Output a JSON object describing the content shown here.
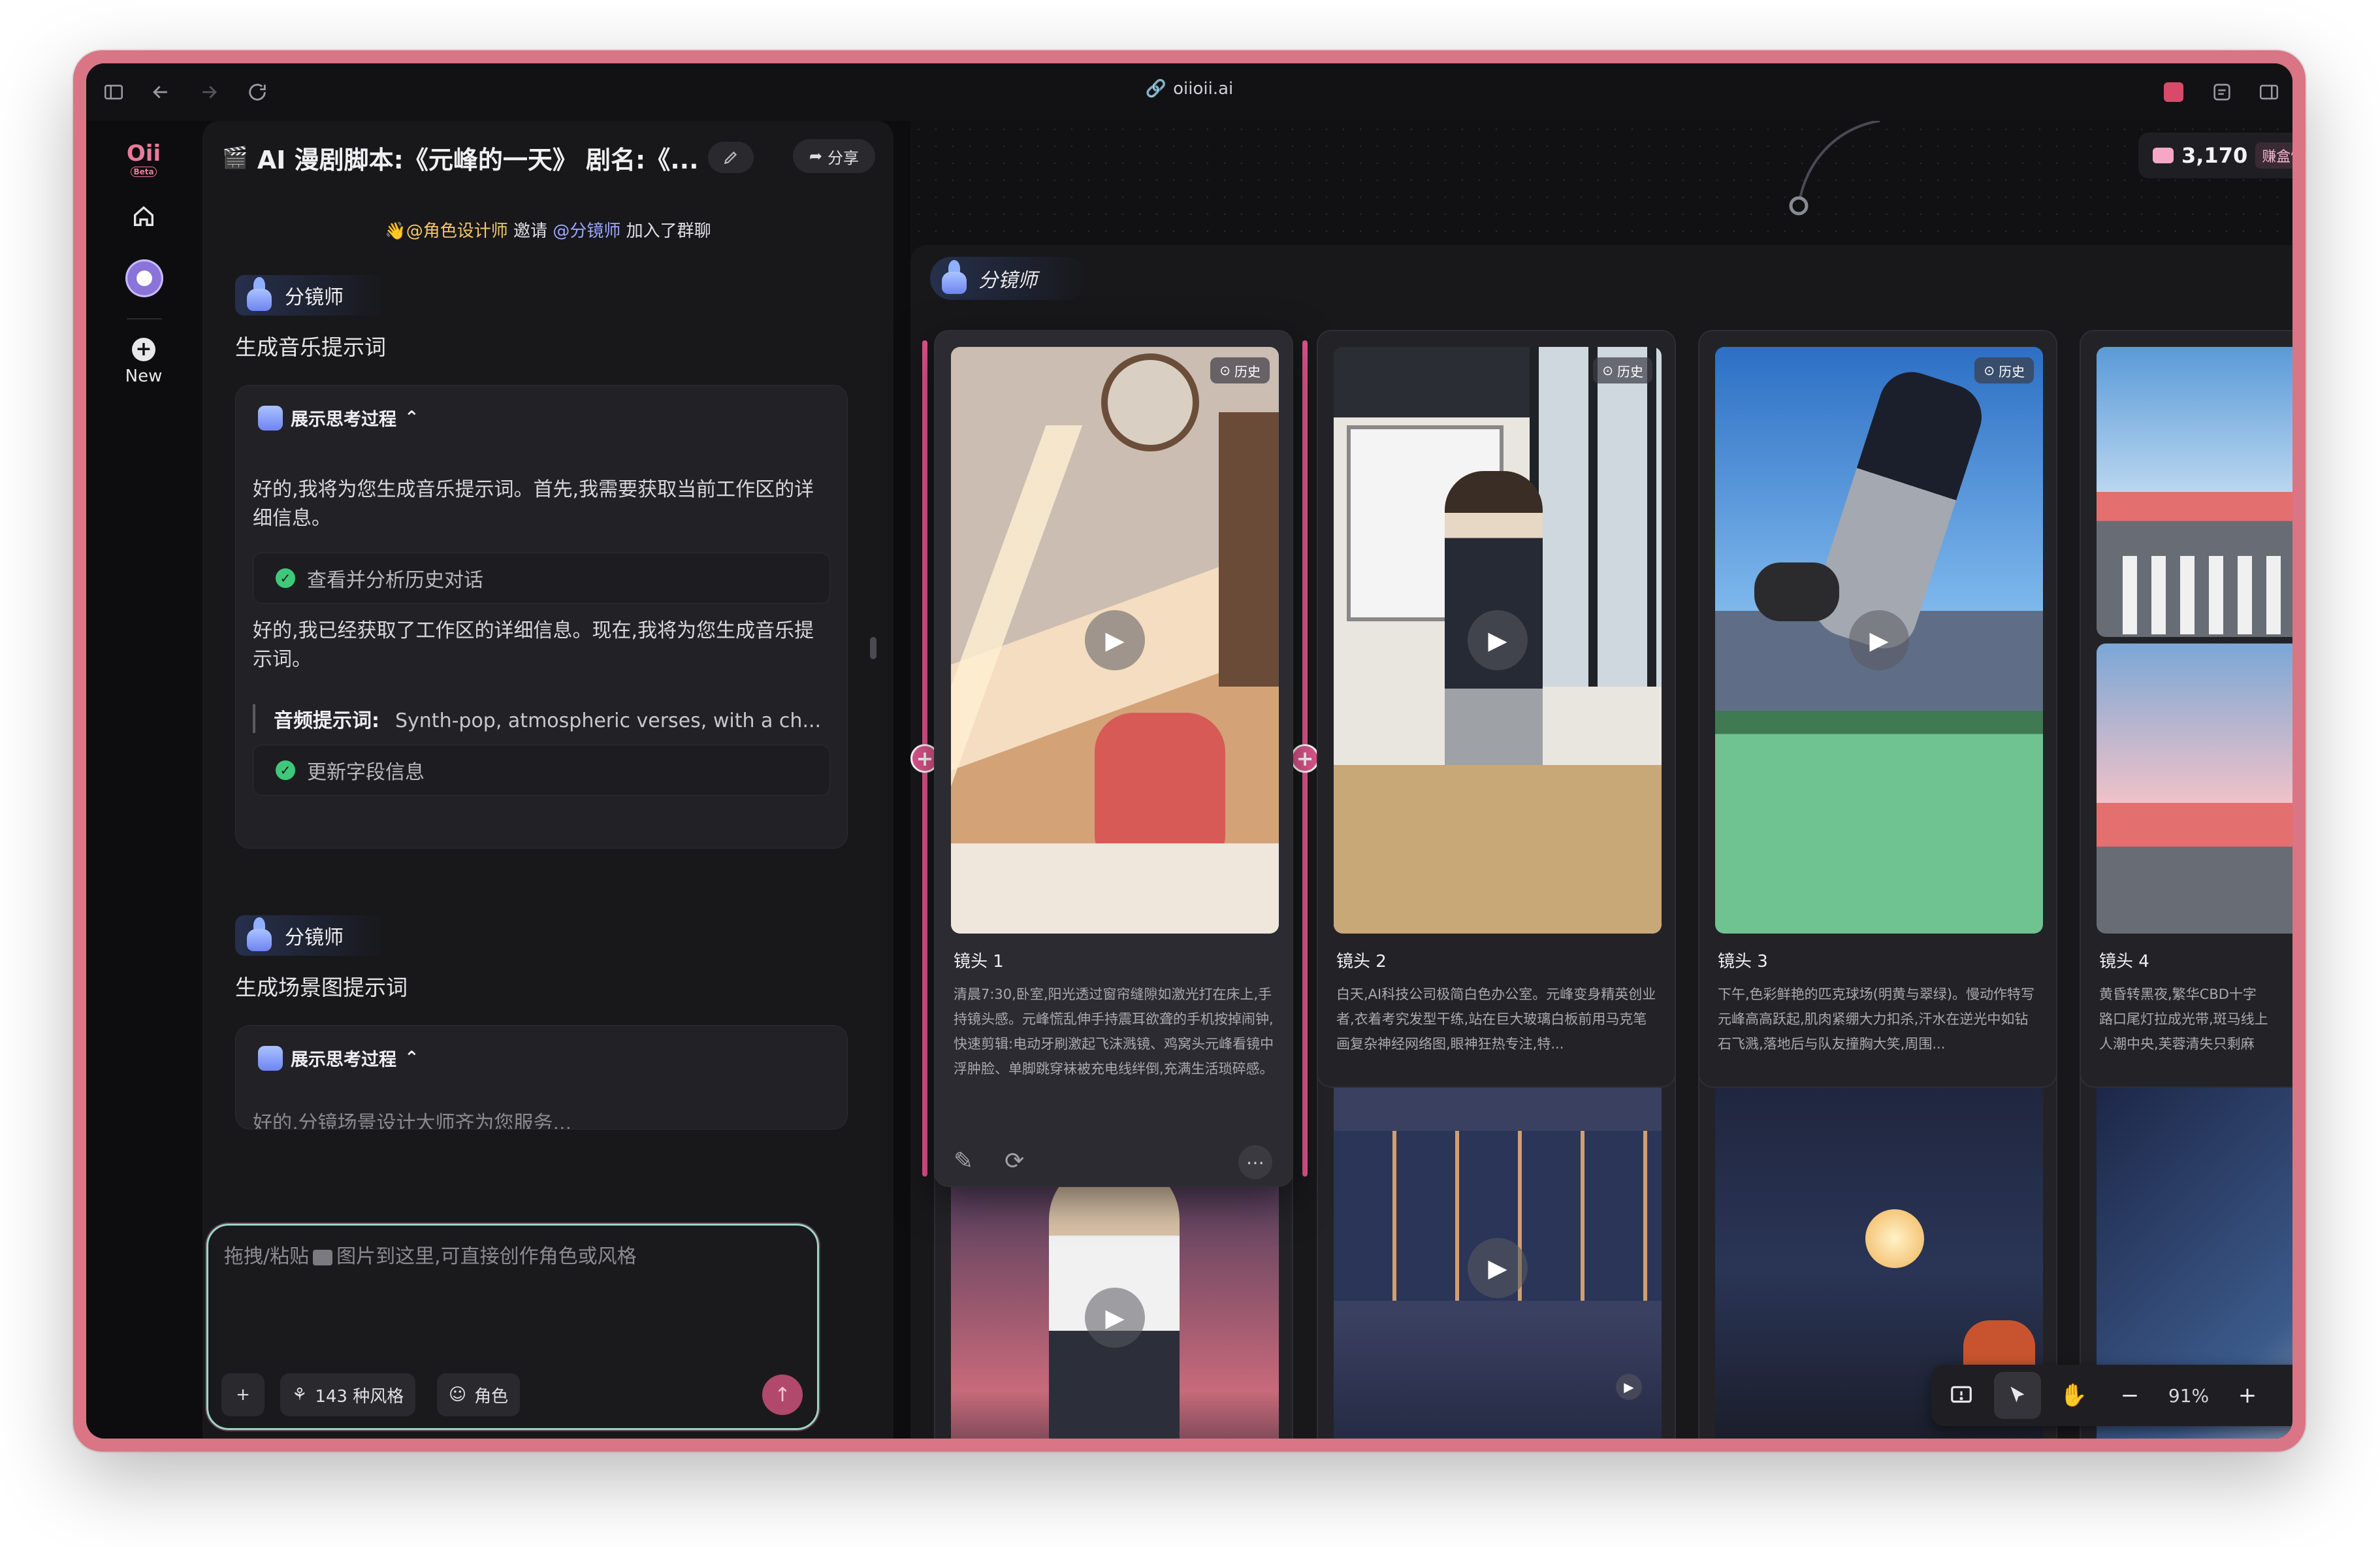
{
  "browser": {
    "url": "oiioii.ai"
  },
  "rail": {
    "logo": "Oii",
    "logo_badge": "Beta",
    "new_label": "New"
  },
  "chat": {
    "title": "AI 漫剧脚本:《元峰的一天》 剧名:《...",
    "share_label": "分享",
    "join_note": {
      "agent1": "👋@角色设计师",
      "invite": "邀请",
      "agent2": "@分镜师",
      "suffix": "加入了群聊"
    },
    "messages": [
      {
        "agent": "分镜师",
        "heading": "生成音乐提示词",
        "think_label": "展示思考过程",
        "para1": "好的,我将为您生成音乐提示词。首先,我需要获取当前工作区的详细信息。",
        "step1": "查看并分析历史对话",
        "para2": "好的,我已经获取了工作区的详细信息。现在,我将为您生成音乐提示词。",
        "audio_label": "音频提示词:",
        "audio_value": "Synth-pop, atmospheric verses, with a ch...",
        "step2": "更新字段信息"
      },
      {
        "agent": "分镜师",
        "heading": "生成场景图提示词",
        "think_label": "展示思考过程",
        "para1": "好的,分镜场景设计大师齐为您服务..."
      }
    ],
    "composer": {
      "placeholder_a": "拖拽/粘贴",
      "placeholder_b": "图片到这里,可直接创作角色或风格",
      "styles_label": "143 种风格",
      "role_label": "角色"
    }
  },
  "canvas": {
    "credits": "3,170",
    "earn": "赚盒饭",
    "frame_label": "分镜师",
    "history_label": "历史",
    "shots": [
      {
        "title": "镜头 1",
        "desc": "清晨7:30,卧室,阳光透过窗帘缝隙如激光打在床上,手持镜头感。元峰慌乱伸手持震耳欲聋的手机按掉闹钟,快速剪辑:电动牙刷激起飞沫溅镜、鸡窝头元峰看镜中浮肿脸、单脚跳穿袜被充电线绊倒,充满生活琐碎感。"
      },
      {
        "title": "镜头 2",
        "desc": "白天,AI科技公司极简白色办公室。元峰变身精英创业者,衣着考究发型干练,站在巨大玻璃白板前用马克笔画复杂神经网络图,眼神狂热专注,特..."
      },
      {
        "title": "镜头 3",
        "desc": "下午,色彩鲜艳的匹克球场(明黄与翠绿)。慢动作特写元峰高高跃起,肌肉紧绷大力扣杀,汗水在逆光中如钻石飞溅,落地后与队友撞胸大笑,周围..."
      },
      {
        "title": "镜头 4",
        "desc": "黄昏转黑夜,繁华CBD十字路口尾灯拉成光带,斑马线上人潮中央,芙蓉清失只剩麻木,周..."
      }
    ],
    "zoom": "91%"
  },
  "colors": {
    "accent_pink": "#e0578f",
    "window_border": "#d97584",
    "composer_border": "#9bd5c7"
  }
}
